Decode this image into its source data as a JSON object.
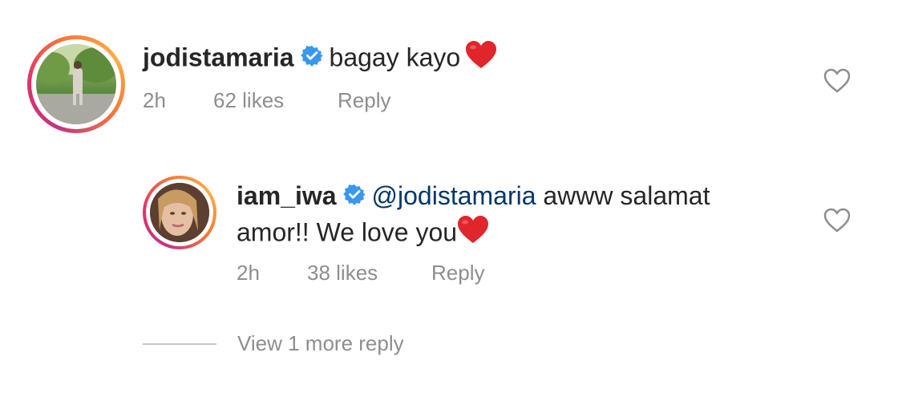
{
  "comments": [
    {
      "username": "jodistamaria",
      "verified": true,
      "text": "bagay kayo",
      "emoji": "red-heart",
      "time": "2h",
      "likes": "62 likes",
      "reply_label": "Reply"
    },
    {
      "username": "iam_iwa",
      "verified": true,
      "mention": "@jodistamaria",
      "text_line1": " awww salamat",
      "text_line2": "amor!! We love you",
      "emoji": "red-heart",
      "time": "2h",
      "likes": "38 likes",
      "reply_label": "Reply"
    }
  ],
  "view_more_replies": "View 1 more reply",
  "colors": {
    "username": "#262626",
    "mention": "#00376b",
    "meta": "#8e8e8e",
    "verified": "#3897f0",
    "heart": "#e0252b"
  }
}
